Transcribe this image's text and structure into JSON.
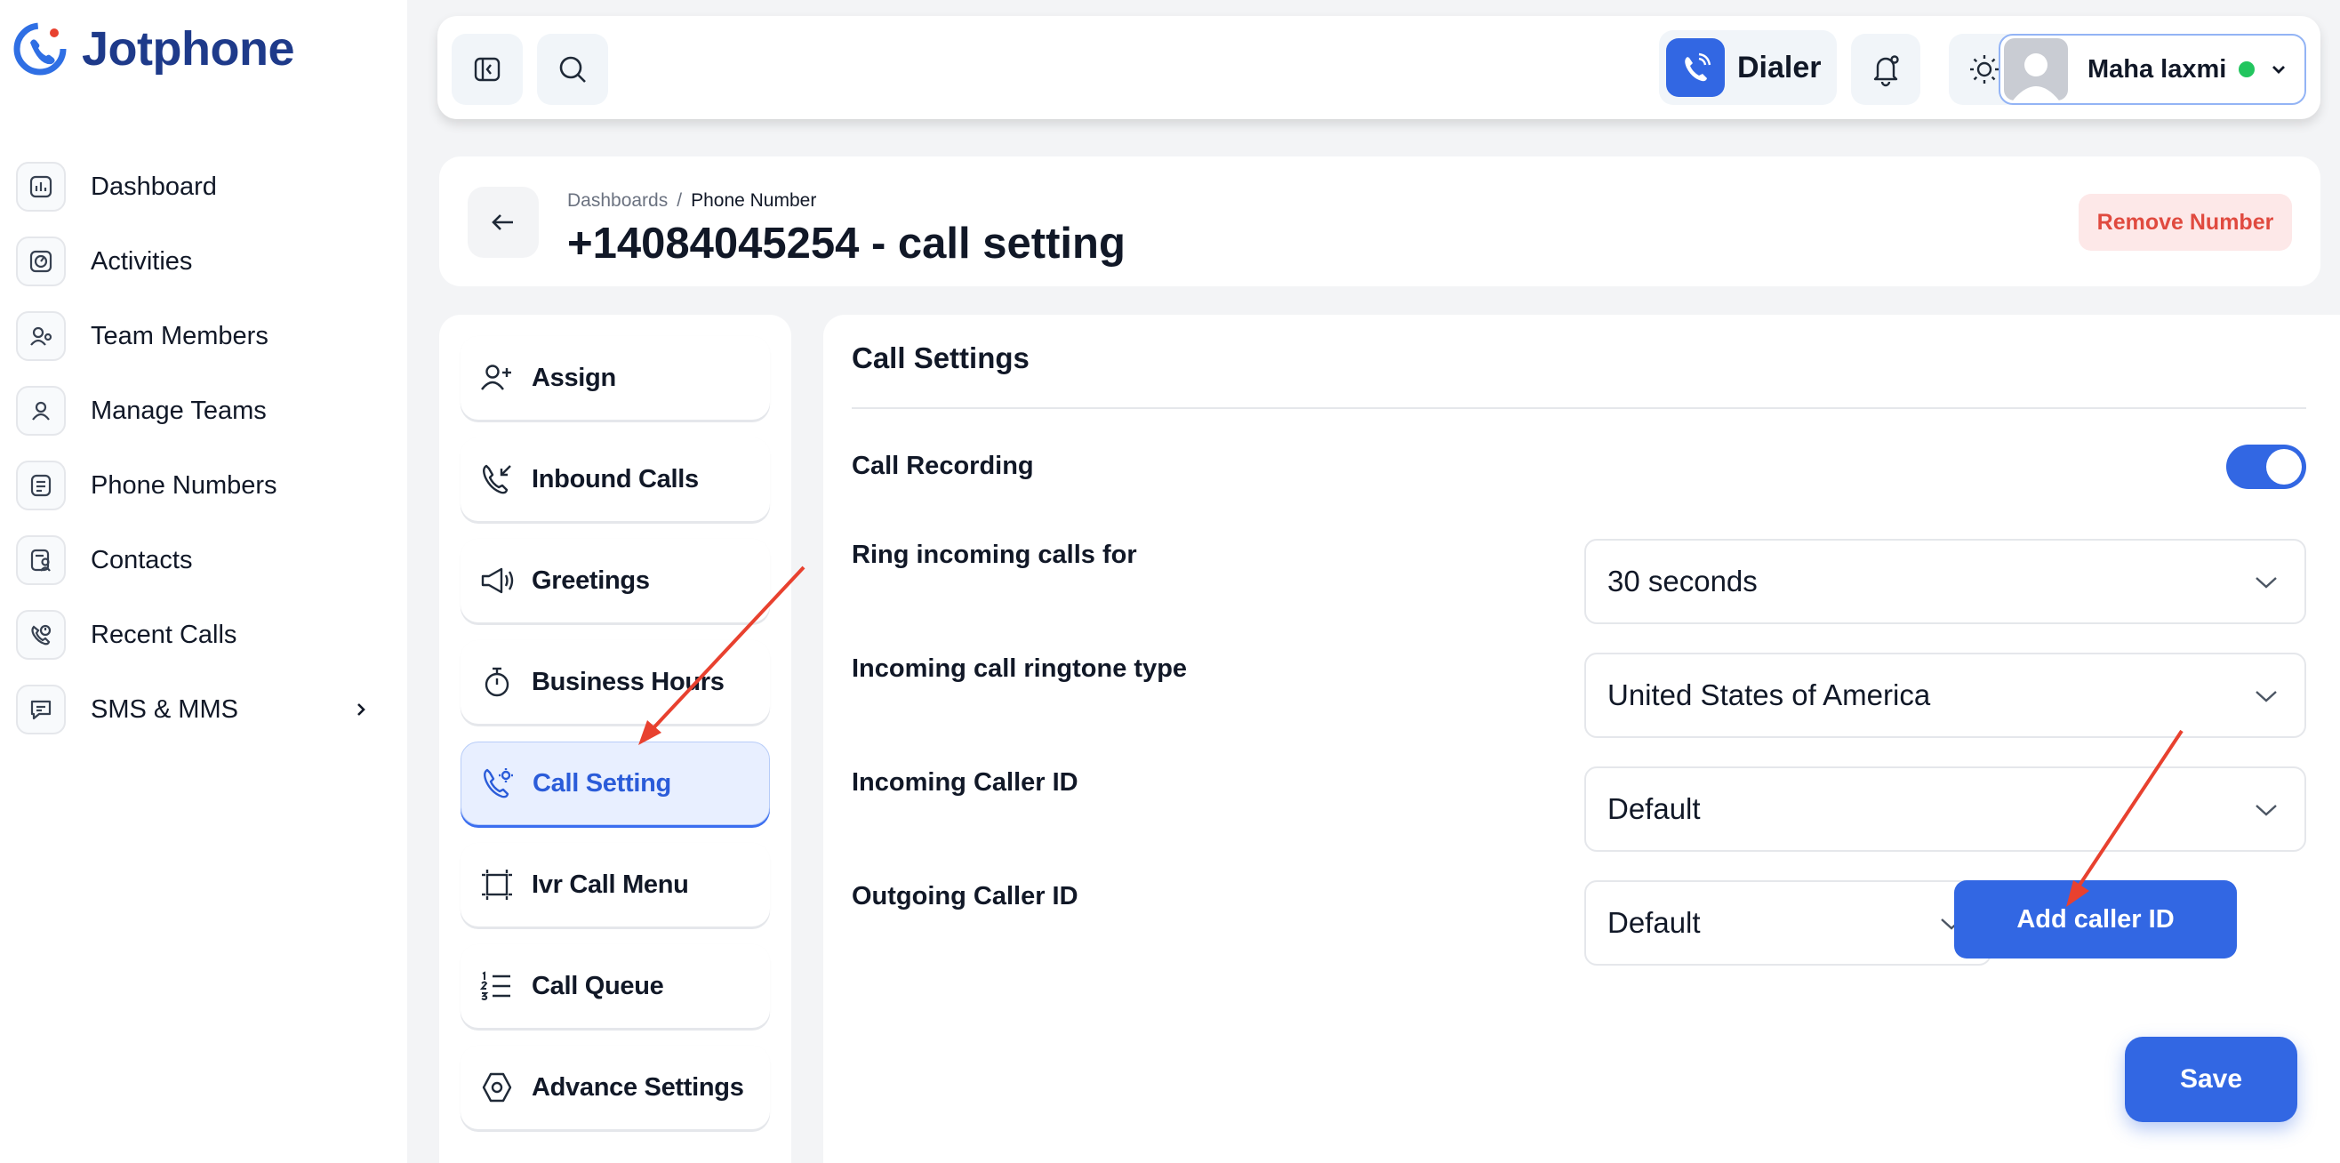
{
  "app": {
    "name": "Jotphone"
  },
  "sidebar": {
    "items": [
      {
        "label": "Dashboard",
        "icon": "dashboard-icon"
      },
      {
        "label": "Activities",
        "icon": "activity-icon"
      },
      {
        "label": "Team Members",
        "icon": "team-members-icon"
      },
      {
        "label": "Manage Teams",
        "icon": "users-icon"
      },
      {
        "label": "Phone Numbers",
        "icon": "phone-list-icon"
      },
      {
        "label": "Contacts",
        "icon": "contacts-icon"
      },
      {
        "label": "Recent Calls",
        "icon": "recent-calls-icon"
      },
      {
        "label": "SMS & MMS",
        "icon": "message-icon"
      }
    ]
  },
  "topbar": {
    "dialer_label": "Dialer",
    "user_name": "Maha laxmi",
    "user_status": "online"
  },
  "header": {
    "breadcrumb": [
      "Dashboards",
      "/",
      "Phone Number"
    ],
    "title": "+14084045254 - call setting",
    "remove_label": "Remove Number"
  },
  "settings_menu": {
    "items": [
      {
        "label": "Assign",
        "icon": "user-plus-icon"
      },
      {
        "label": "Inbound Calls",
        "icon": "inbound-call-icon"
      },
      {
        "label": "Greetings",
        "icon": "megaphone-icon"
      },
      {
        "label": "Business Hours",
        "icon": "stopwatch-icon"
      },
      {
        "label": "Call Setting",
        "icon": "phone-settings-icon",
        "active": true
      },
      {
        "label": "Ivr Call Menu",
        "icon": "ivr-frame-icon"
      },
      {
        "label": "Call Queue",
        "icon": "numbered-list-icon"
      },
      {
        "label": "Advance Settings",
        "icon": "hexagon-settings-icon"
      }
    ]
  },
  "call_settings": {
    "title": "Call Settings",
    "call_recording": {
      "label": "Call Recording",
      "enabled": true
    },
    "ring_duration": {
      "label": "Ring incoming calls for",
      "value": "30 seconds"
    },
    "ringtone_type": {
      "label": "Incoming call ringtone type",
      "value": "United States of America"
    },
    "incoming_caller_id": {
      "label": "Incoming Caller ID",
      "value": "Default"
    },
    "outgoing_caller_id": {
      "label": "Outgoing Caller ID",
      "value": "Default"
    },
    "add_caller_id_label": "Add caller ID",
    "save_label": "Save"
  },
  "colors": {
    "accent": "#3267e3",
    "danger": "#e04a3f",
    "annotation_arrow": "#e8412f"
  }
}
